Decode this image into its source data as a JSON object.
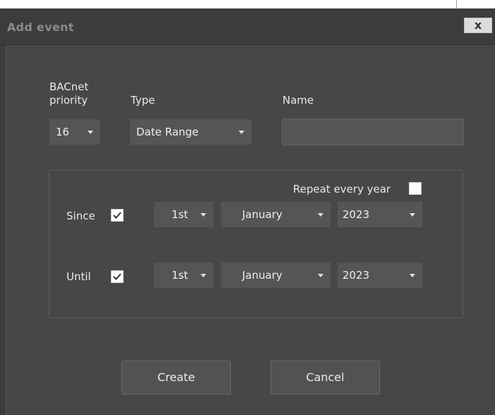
{
  "window": {
    "title": "Add event",
    "close_glyph": "x",
    "close_icon": "close-icon"
  },
  "fields": {
    "priority": {
      "label": "BACnet priority",
      "label_line1": "BACnet",
      "label_line2": "priority",
      "value": "16"
    },
    "type": {
      "label": "Type",
      "value": "Date Range"
    },
    "name": {
      "label": "Name",
      "value": "",
      "placeholder": ""
    }
  },
  "date_range": {
    "repeat_every_year": {
      "label": "Repeat every year",
      "checked": false
    },
    "since": {
      "label": "Since",
      "checked": true,
      "day": "1st",
      "month": "January",
      "year": "2023"
    },
    "until": {
      "label": "Until",
      "checked": true,
      "day": "1st",
      "month": "January",
      "year": "2023"
    }
  },
  "actions": {
    "create_label": "Create",
    "cancel_label": "Cancel"
  },
  "colors": {
    "dialog_bg": "#474747",
    "control_bg": "#555555",
    "titlebar_bg": "#3c3c3c",
    "text": "#e6e6e6"
  }
}
